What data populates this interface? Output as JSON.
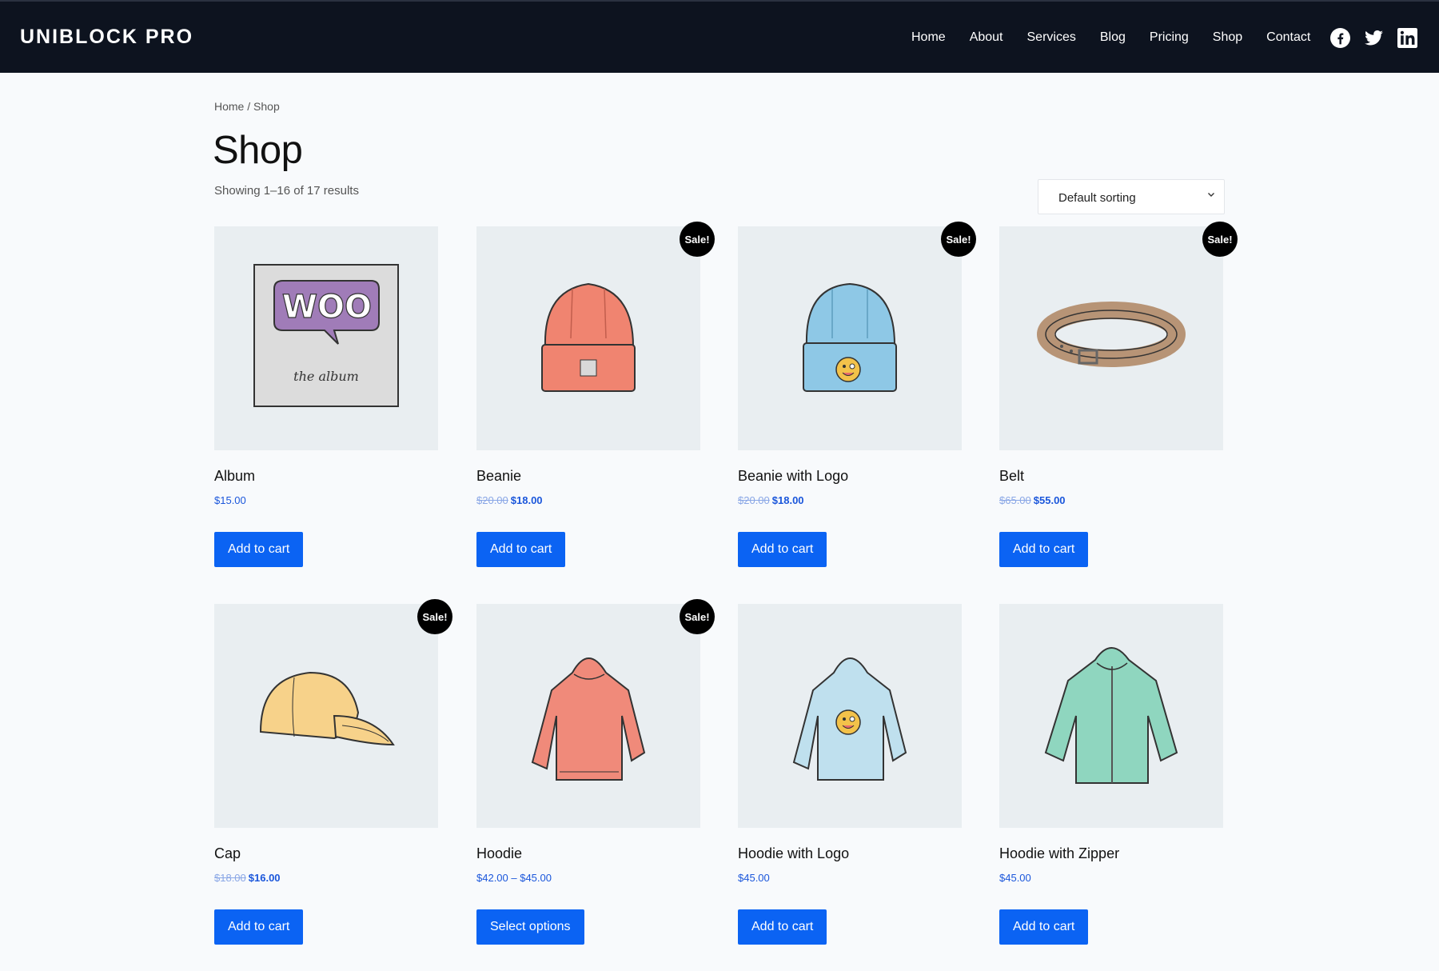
{
  "header": {
    "brand": "UNIBLOCK PRO",
    "nav": [
      "Home",
      "About",
      "Services",
      "Blog",
      "Pricing",
      "Shop",
      "Contact"
    ],
    "socials": [
      "facebook-icon",
      "twitter-icon",
      "linkedin-icon"
    ]
  },
  "breadcrumb": {
    "home": "Home",
    "sep": " / ",
    "current": "Shop"
  },
  "page": {
    "title": "Shop",
    "result_count": "Showing 1–16 of 17 results",
    "sort_label": "Default sorting"
  },
  "products": [
    {
      "name": "Album",
      "price": "$15.00",
      "old_price": "",
      "sale": false,
      "button": "Add to cart"
    },
    {
      "name": "Beanie",
      "price": "$18.00",
      "old_price": "$20.00",
      "sale": true,
      "button": "Add to cart"
    },
    {
      "name": "Beanie with Logo",
      "price": "$18.00",
      "old_price": "$20.00",
      "sale": true,
      "button": "Add to cart"
    },
    {
      "name": "Belt",
      "price": "$55.00",
      "old_price": "$65.00",
      "sale": true,
      "button": "Add to cart"
    },
    {
      "name": "Cap",
      "price": "$16.00",
      "old_price": "$18.00",
      "sale": true,
      "button": "Add to cart"
    },
    {
      "name": "Hoodie",
      "price": "$42.00 – $45.00",
      "old_price": "",
      "sale": true,
      "button": "Select options"
    },
    {
      "name": "Hoodie with Logo",
      "price": "$45.00",
      "old_price": "",
      "sale": false,
      "button": "Add to cart"
    },
    {
      "name": "Hoodie with Zipper",
      "price": "$45.00",
      "old_price": "",
      "sale": false,
      "button": "Add to cart"
    }
  ],
  "sale_badge": "Sale!",
  "album_art_text": {
    "main": "WOO",
    "sub": "the album"
  },
  "colors": {
    "header_bg": "#0d131f",
    "accent_button": "#0b63f3",
    "price_text": "#1a56db",
    "sale_badge_bg": "#000000",
    "thumb_bg": "#e9eef1"
  }
}
